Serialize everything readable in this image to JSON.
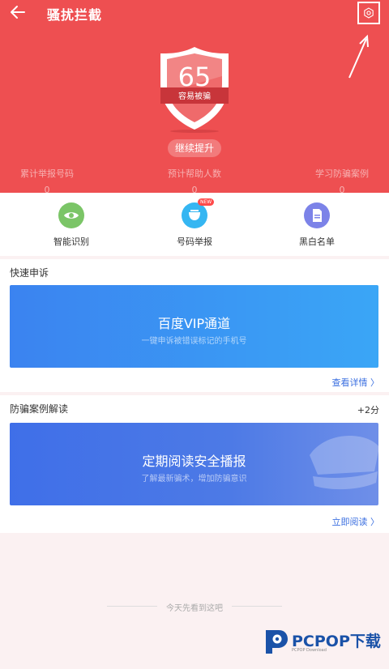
{
  "header": {
    "title": "骚扰拦截",
    "back_icon": "arrow-left-icon",
    "settings_icon": "gear-icon"
  },
  "shield": {
    "score": "65",
    "status": "容易被骗",
    "action": "继续提升"
  },
  "stats": [
    {
      "label": "累计举报号码",
      "value": "0"
    },
    {
      "label": "预计帮助人数",
      "value": "0"
    },
    {
      "label": "学习防骗案例",
      "value": "0"
    }
  ],
  "features": [
    {
      "label": "智能识别",
      "icon": "eye-icon",
      "color": "#7bc567"
    },
    {
      "label": "号码举报",
      "icon": "report-icon",
      "color": "#35b6f2",
      "badge": "NEW"
    },
    {
      "label": "黑白名单",
      "icon": "document-icon",
      "color": "#7c83e8"
    }
  ],
  "quick_appeal": {
    "title": "快速申诉",
    "banner_title": "百度VIP通道",
    "banner_subtitle": "一键申诉被错误标记的手机号",
    "link": "查看详情 〉"
  },
  "fraud_cases": {
    "title": "防骗案例解读",
    "points": "+2分",
    "banner_title": "定期阅读安全播报",
    "banner_subtitle": "了解最新骗术，增加防骗意识",
    "link": "立即阅读 〉"
  },
  "footer": {
    "text": "今天先看到这吧"
  },
  "watermark": {
    "brand": "PCPOP下载",
    "sub": "PCPOP Download"
  },
  "colors": {
    "hero": "#ee4f51",
    "link": "#3b6fe0"
  }
}
